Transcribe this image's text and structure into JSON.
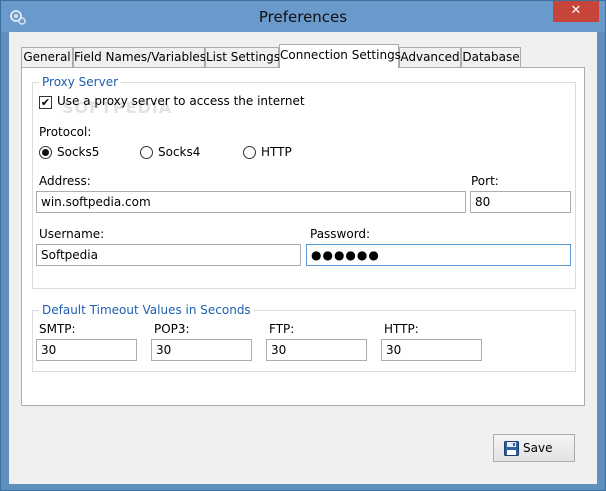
{
  "window": {
    "title": "Preferences",
    "close_glyph": "✕"
  },
  "tabs": [
    {
      "label": "General"
    },
    {
      "label": "Field Names/Variables"
    },
    {
      "label": "List Settings"
    },
    {
      "label": "Connection Settings"
    },
    {
      "label": "Advanced"
    },
    {
      "label": "Database"
    }
  ],
  "active_tab": "Connection Settings",
  "watermark": "SOFTPEDIA",
  "proxy": {
    "group_title": "Proxy Server",
    "use_proxy_label": "Use a proxy server to access the internet",
    "use_proxy_checked": true,
    "protocol_label": "Protocol:",
    "protocols": [
      {
        "label": "Socks5",
        "selected": true
      },
      {
        "label": "Socks4",
        "selected": false
      },
      {
        "label": "HTTP",
        "selected": false
      }
    ],
    "address_label": "Address:",
    "address_value": "win.softpedia.com",
    "port_label": "Port:",
    "port_value": "80",
    "username_label": "Username:",
    "username_value": "Softpedia",
    "password_label": "Password:",
    "password_value": "●●●●●●"
  },
  "timeouts": {
    "group_title": "Default Timeout Values in Seconds",
    "smtp_label": "SMTP:",
    "smtp_value": "30",
    "pop3_label": "POP3:",
    "pop3_value": "30",
    "ftp_label": "FTP:",
    "ftp_value": "30",
    "http_label": "HTTP:",
    "http_value": "30"
  },
  "footer": {
    "save_label": "Save",
    "save_icon": "floppy-disk-icon"
  },
  "colors": {
    "title_bar": "#6a9acb",
    "accent_text": "#1f5fb0",
    "close_button": "#c7443a"
  }
}
